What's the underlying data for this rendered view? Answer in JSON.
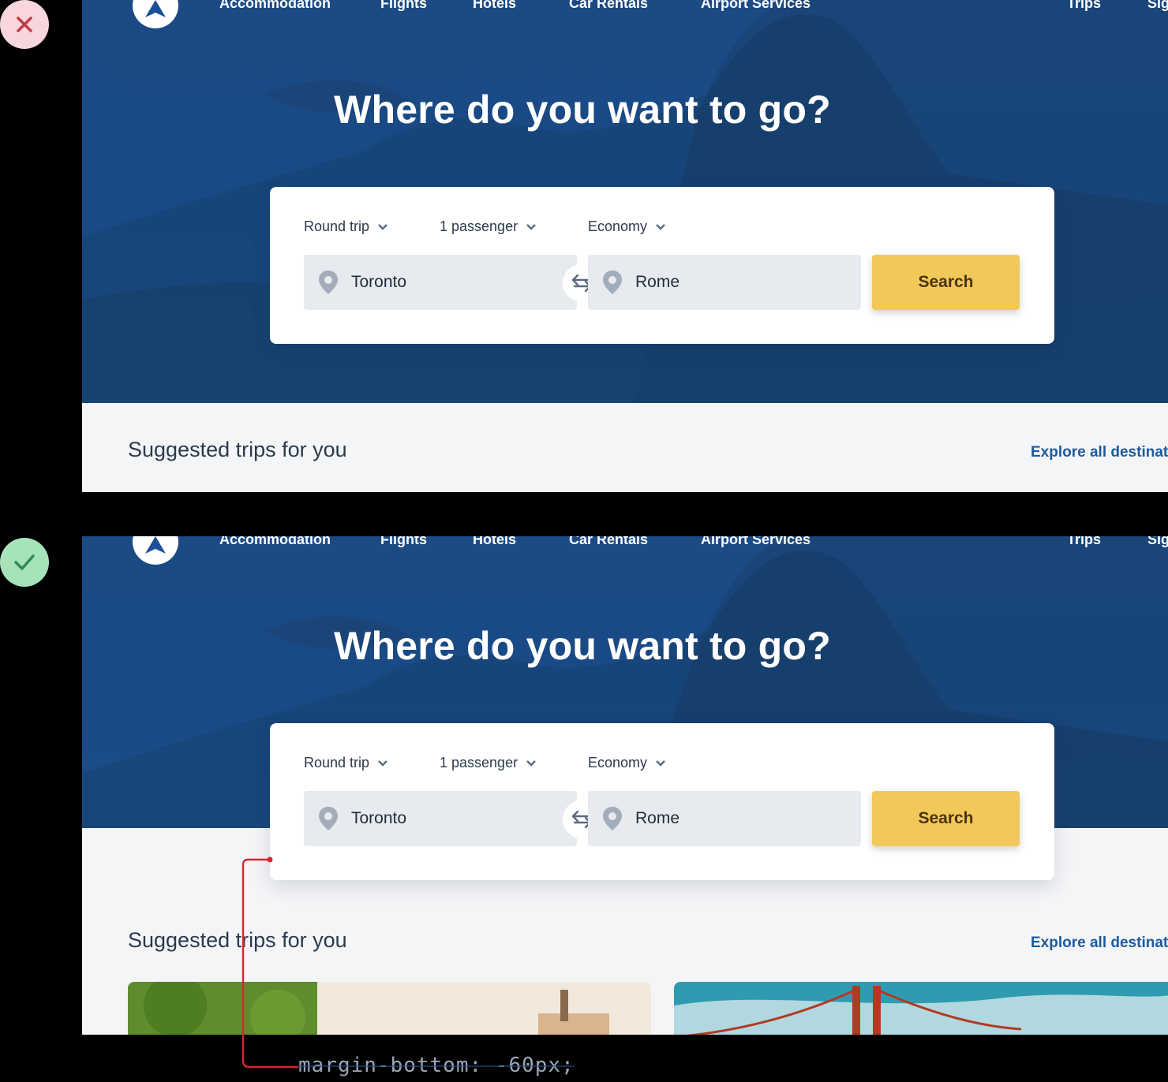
{
  "examples": [
    {
      "status": "incorrect",
      "badge_icon": "close-icon",
      "badge_color": "#c23b4a"
    },
    {
      "status": "correct",
      "badge_icon": "check-icon",
      "badge_color": "#2f8a55"
    }
  ],
  "nav": {
    "items": [
      "Accommodation",
      "Flights",
      "Hotels",
      "Car Rentals",
      "Airport Services"
    ],
    "right_items": [
      "Trips",
      "Sig"
    ]
  },
  "hero": {
    "headline": "Where do you want to go?"
  },
  "search_form": {
    "trip_type": "Round trip",
    "passengers": "1 passenger",
    "cabin_class": "Economy",
    "origin": "Toronto",
    "destination": "Rome",
    "search_label": "Search"
  },
  "section": {
    "title": "Suggested trips for you",
    "link": "Explore all destinati"
  },
  "annotation": {
    "code": "margin-bottom: -60px;",
    "color": "#d8262e"
  },
  "colors": {
    "hero_blue": "#1a4a86",
    "accent_yellow": "#f3c85a",
    "link_blue": "#1d5a9c",
    "page_bg": "#f4f5f7"
  }
}
